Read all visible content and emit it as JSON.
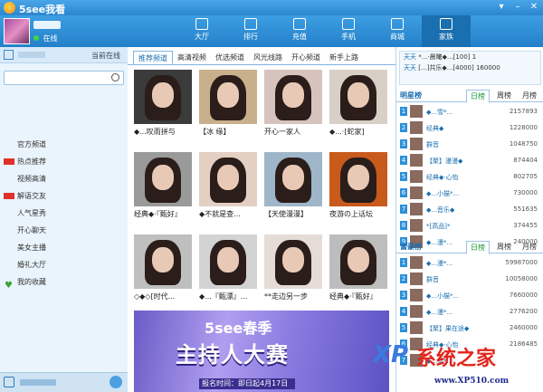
{
  "app": {
    "title": "5see我看"
  },
  "user": {
    "status": "在线"
  },
  "nav": [
    {
      "label": "大厅",
      "active": false
    },
    {
      "label": "排行",
      "active": false
    },
    {
      "label": "充值",
      "active": false
    },
    {
      "label": "手机",
      "active": false
    },
    {
      "label": "商城",
      "active": false
    },
    {
      "label": "家族",
      "active": true
    }
  ],
  "sidebar": {
    "online_label": "当前在线",
    "search_placeholder": "",
    "items": [
      {
        "label": "官方频道",
        "count": ""
      },
      {
        "label": "热点推荐",
        "count": "",
        "badge": true
      },
      {
        "label": "视频高清",
        "count": ""
      },
      {
        "label": "解语交友",
        "count": "",
        "badge": true
      },
      {
        "label": "人气星秀",
        "count": ""
      },
      {
        "label": "开心聊天",
        "count": ""
      },
      {
        "label": "美女主播",
        "count": ""
      },
      {
        "label": "婚礼大厅",
        "count": ""
      },
      {
        "label": "我的收藏",
        "count": "",
        "heart": true
      }
    ]
  },
  "tabs": [
    {
      "label": "推荐频道",
      "active": true
    },
    {
      "label": "高清视频",
      "active": false
    },
    {
      "label": "优选频道",
      "active": false
    },
    {
      "label": "风光线路",
      "active": false
    },
    {
      "label": "开心频道",
      "active": false
    },
    {
      "label": "新手上路",
      "active": false
    }
  ],
  "cards": [
    {
      "title": "◆...叹雨拼与",
      "meta": "",
      "bg": "#3b3b3b"
    },
    {
      "title": "【冰 缘】",
      "meta": "",
      "bg": "#c9b08c"
    },
    {
      "title": "开心一家人",
      "meta": "",
      "bg": "#d7c3be"
    },
    {
      "title": "◆...·[蛇家]",
      "meta": "",
      "bg": "#d8cfc7"
    },
    {
      "title": "经典◆·『甄好』",
      "meta": "",
      "bg": "#9a9a9a"
    },
    {
      "title": "◆不就是查...",
      "meta": "",
      "bg": "#e4cfc3"
    },
    {
      "title": "【天使漫漫】",
      "meta": "",
      "bg": "#9fb6c8"
    },
    {
      "title": "夜游の上话坛",
      "meta": "",
      "bg": "#c85a1c"
    },
    {
      "title": "◇◆◇[时代...",
      "meta": "",
      "bg": "#bfbfbf"
    },
    {
      "title": "◆...『甄漂』...",
      "meta": "",
      "bg": "#d3d3d3"
    },
    {
      "title": "**走边另一步",
      "meta": "",
      "bg": "#e6dcd6"
    },
    {
      "title": "经典◆·『甄好』",
      "meta": "",
      "bg": "#bdbdbd"
    }
  ],
  "banner": {
    "line1": "5see春季",
    "line2": "主持人大赛",
    "date": "报名时间：即日起4月17日"
  },
  "announce": [
    {
      "label": "天天",
      "text": "*...·晨曦◆...[100]",
      "num": "1"
    },
    {
      "label": "天天",
      "text": "[...]共乐◆...[4000]",
      "num": "160000"
    }
  ],
  "rank1": {
    "title": "明星榜",
    "tabs": [
      "日榜",
      "周榜",
      "月榜"
    ],
    "rows": [
      {
        "name": "◆...雪*...",
        "score": "2157893"
      },
      {
        "name": "经典◆",
        "score": "1228000"
      },
      {
        "name": "群音",
        "score": "1048750"
      },
      {
        "name": "【聚】漫漫◆",
        "score": "874404"
      },
      {
        "name": "经典◆·心怡",
        "score": "802705"
      },
      {
        "name": "◆...小猫*...",
        "score": "730000"
      },
      {
        "name": "◆...音乐◆",
        "score": "551635"
      },
      {
        "name": "*[高品]*",
        "score": "374455"
      },
      {
        "name": "◆...漫*...",
        "score": "240000"
      }
    ]
  },
  "rank2": {
    "title": "富豪榜",
    "tabs": [
      "日榜",
      "周榜",
      "月榜"
    ],
    "rows": [
      {
        "name": "◆...漫*...",
        "score": "59987000"
      },
      {
        "name": "群音",
        "score": "10058000"
      },
      {
        "name": "◆...小猫*...",
        "score": "7660000"
      },
      {
        "name": "◆...漫*...",
        "score": "2776200"
      },
      {
        "name": "【聚】果在途◆",
        "score": "2460000"
      },
      {
        "name": "经典◆·心怡",
        "score": "2186485"
      },
      {
        "name": "◆...雪*...",
        "score": ""
      }
    ]
  },
  "watermark": {
    "badge": "XP",
    "text": "系统之家",
    "url": "www.XP510.com"
  },
  "colors": {
    "accent": "#2a86cf",
    "rank_green": "#1a9a3a"
  }
}
